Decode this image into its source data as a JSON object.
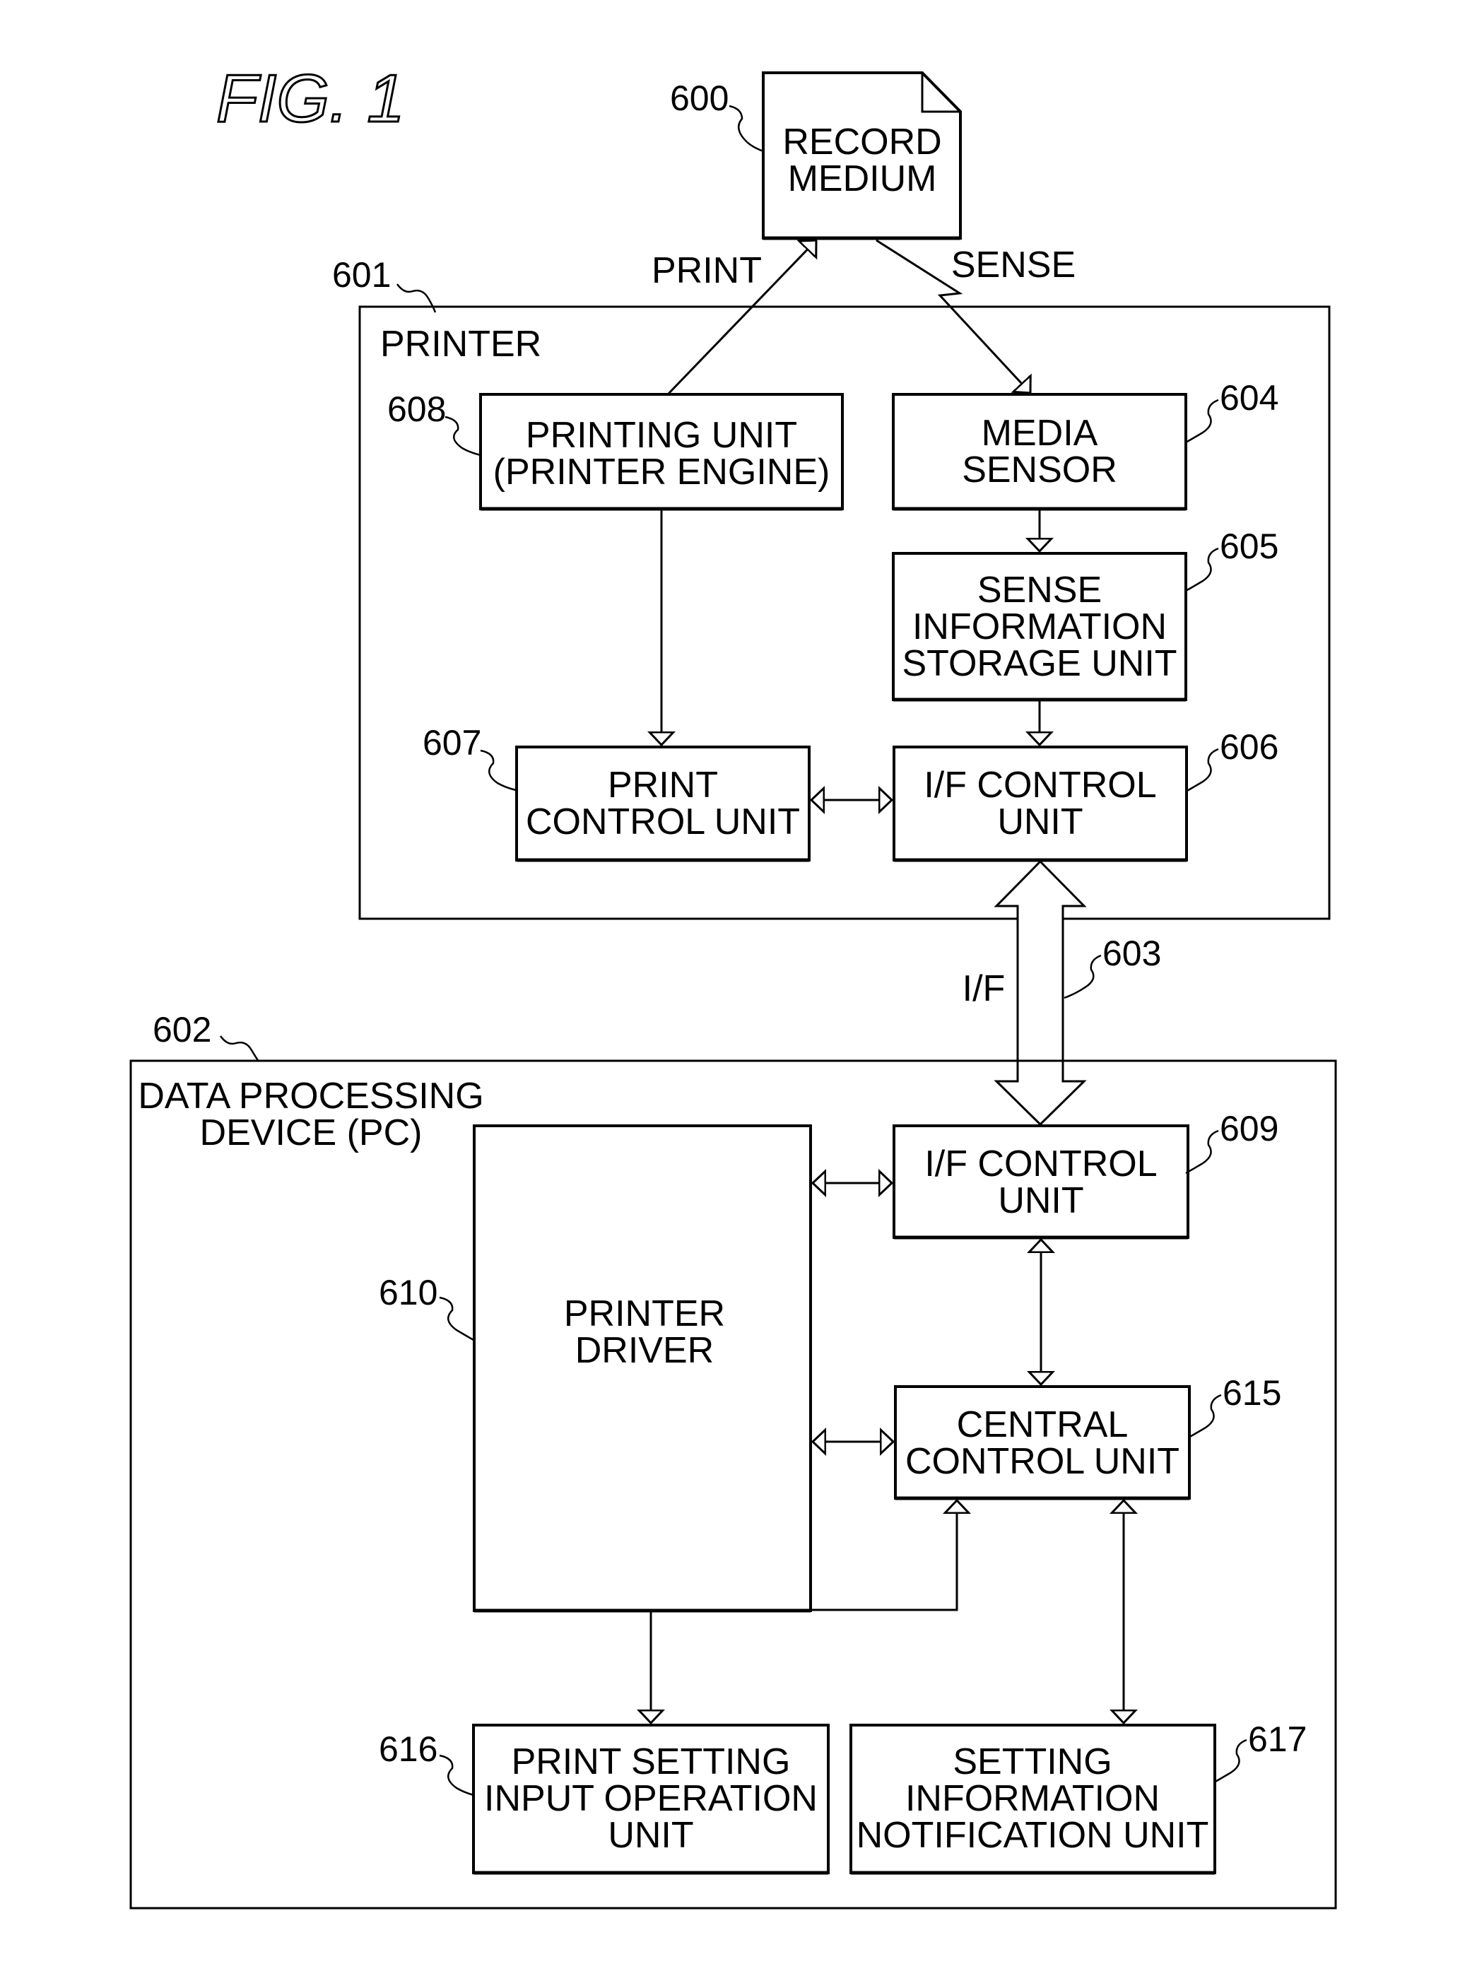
{
  "figure": {
    "title": "FIG. 1"
  },
  "record_medium": {
    "ref": "600",
    "lines": [
      "RECORD",
      "MEDIUM"
    ]
  },
  "flows": {
    "print": "PRINT",
    "sense": "SENSE",
    "interface": "I/F",
    "interface_ref": "603"
  },
  "printer": {
    "ref": "601",
    "title": "PRINTER",
    "blocks": {
      "printing_unit": {
        "ref": "608",
        "lines": [
          "PRINTING UNIT",
          "(PRINTER ENGINE)"
        ]
      },
      "media_sensor": {
        "ref": "604",
        "lines": [
          "MEDIA",
          "SENSOR"
        ]
      },
      "sense_storage": {
        "ref": "605",
        "lines": [
          "SENSE",
          "INFORMATION",
          "STORAGE UNIT"
        ]
      },
      "print_control": {
        "ref": "607",
        "lines": [
          "PRINT",
          "CONTROL UNIT"
        ]
      },
      "if_control": {
        "ref": "606",
        "lines": [
          "I/F CONTROL",
          "UNIT"
        ]
      }
    }
  },
  "pc": {
    "ref": "602",
    "title_lines": [
      "DATA PROCESSING",
      "DEVICE (PC)"
    ],
    "blocks": {
      "printer_driver": {
        "ref": "610",
        "lines": [
          "PRINTER",
          "DRIVER"
        ]
      },
      "if_control": {
        "ref": "609",
        "lines": [
          "I/F CONTROL",
          "UNIT"
        ]
      },
      "central_control": {
        "ref": "615",
        "lines": [
          "CENTRAL",
          "CONTROL UNIT"
        ]
      },
      "print_setting_input": {
        "ref": "616",
        "lines": [
          "PRINT SETTING",
          "INPUT OPERATION",
          "UNIT"
        ]
      },
      "setting_notification": {
        "ref": "617",
        "lines": [
          "SETTING",
          "INFORMATION",
          "NOTIFICATION UNIT"
        ]
      }
    }
  }
}
